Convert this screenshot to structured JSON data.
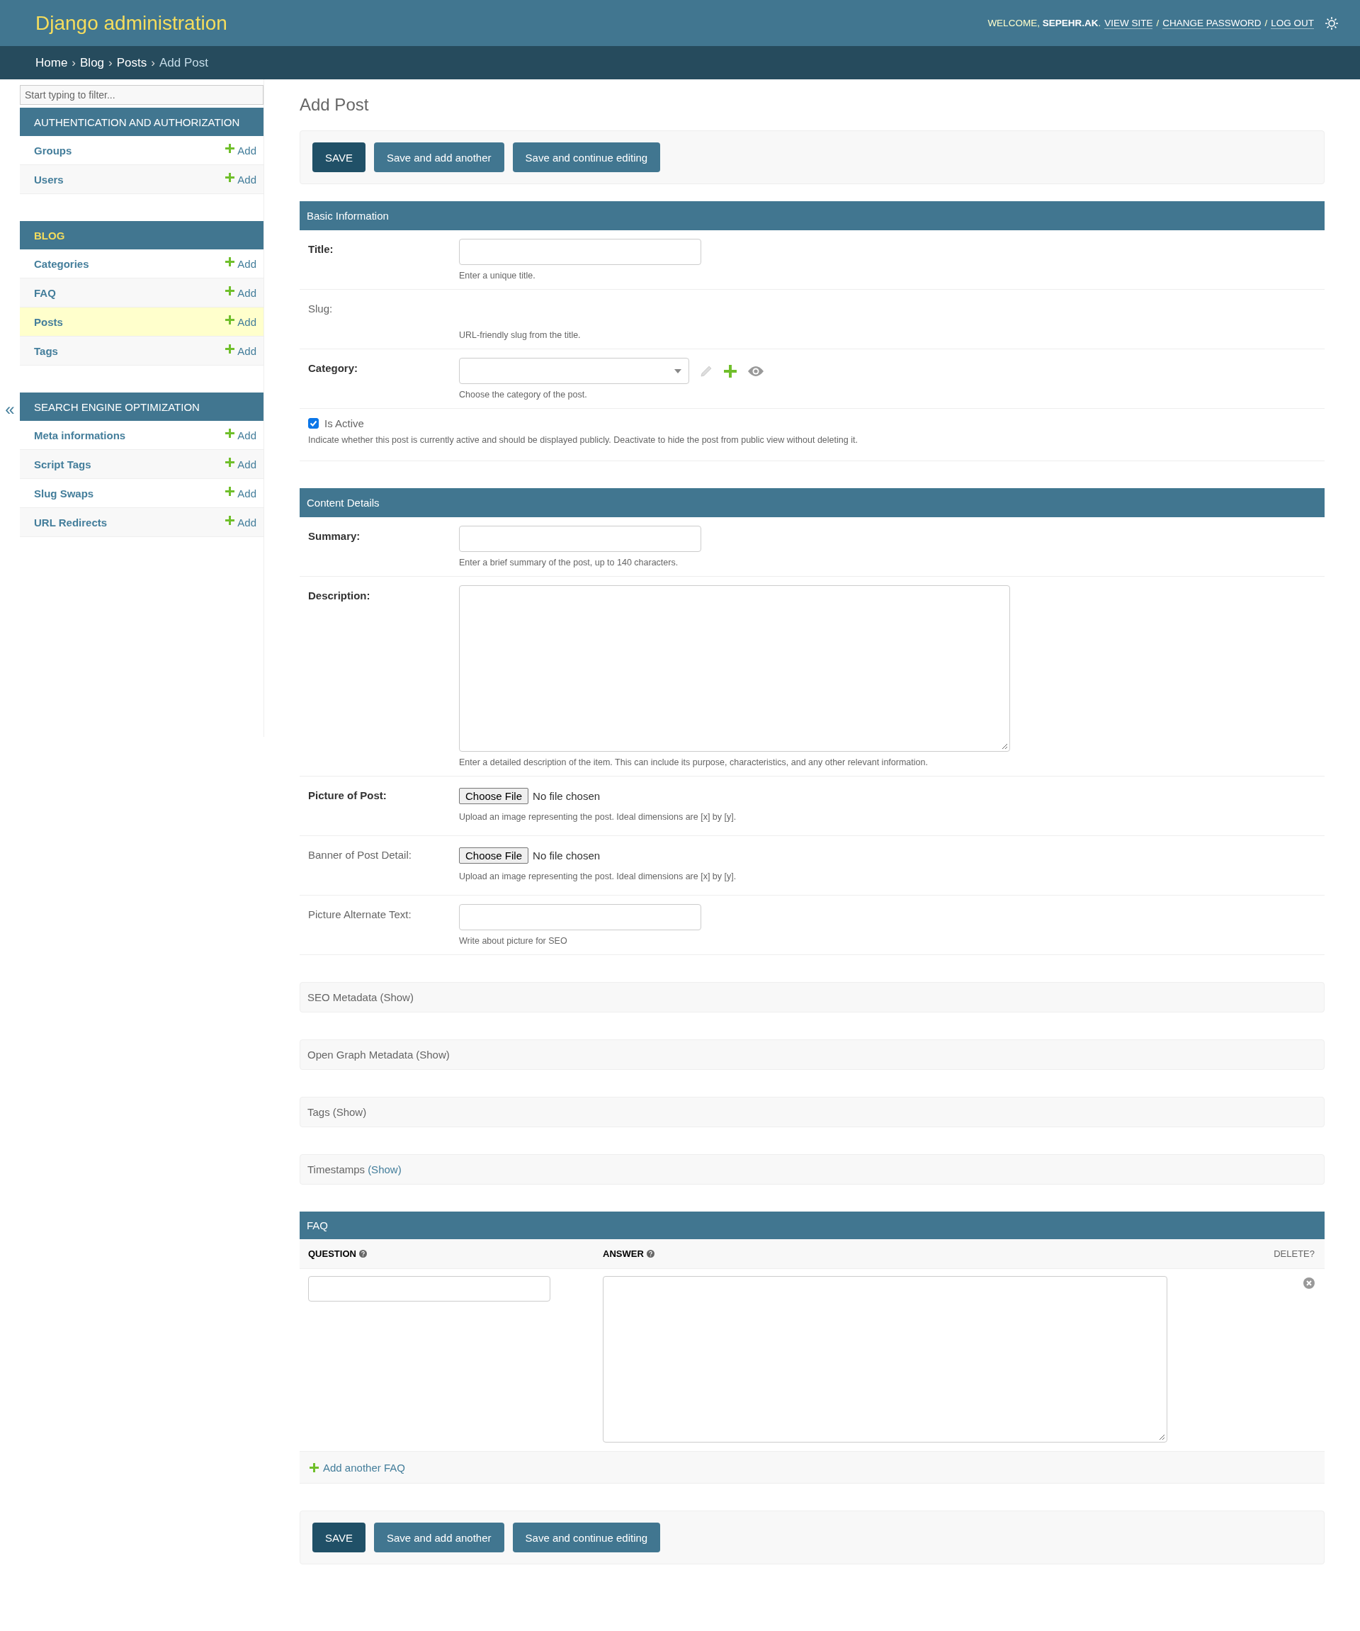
{
  "header": {
    "site_name": "Django administration",
    "welcome": "WELCOME, **SEPEHR.AK**.",
    "user_links": [
      {
        "kind": "link",
        "text": "VIEW SITE"
      },
      {
        "kind": "separator",
        "text": "/"
      },
      {
        "kind": "link",
        "text": "CHANGE PASSWORD"
      },
      {
        "kind": "separator",
        "text": "/"
      },
      {
        "kind": "link",
        "text": "LOG OUT"
      }
    ]
  },
  "breadcrumbs": [
    {
      "kind": "link",
      "text": "Home"
    },
    {
      "kind": "separator",
      "text": "›"
    },
    {
      "kind": "link",
      "text": "Blog"
    },
    {
      "kind": "separator",
      "text": "›"
    },
    {
      "kind": "link",
      "text": "Posts"
    },
    {
      "kind": "separator",
      "text": "›"
    },
    {
      "kind": "current",
      "text": "Add Post"
    }
  ],
  "sidebar": {
    "filter": {
      "placeholder": "Start typing to filter..."
    },
    "collapse_toggle": "«",
    "sections": [
      {
        "title": "AUTHENTICATION AND AUTHORIZATION",
        "selected": false,
        "items": [
          {
            "name": "Groups",
            "add": "Add",
            "selected": false
          },
          {
            "name": "Users",
            "add": "Add",
            "selected": false
          }
        ]
      },
      {
        "title": "BLOG",
        "selected": true,
        "items": [
          {
            "name": "Categories",
            "add": "Add",
            "selected": false
          },
          {
            "name": "FAQ",
            "add": "Add",
            "selected": false
          },
          {
            "name": "Posts",
            "add": "Add",
            "selected": true
          },
          {
            "name": "Tags",
            "add": "Add",
            "selected": false
          }
        ]
      },
      {
        "title": "SEARCH ENGINE OPTIMIZATION",
        "selected": false,
        "items": [
          {
            "name": "Meta informations",
            "add": "Add",
            "selected": false
          },
          {
            "name": "Script Tags",
            "add": "Add",
            "selected": false
          },
          {
            "name": "Slug Swaps",
            "add": "Add",
            "selected": false
          },
          {
            "name": "URL Redirects",
            "add": "Add",
            "selected": false
          }
        ]
      }
    ]
  },
  "page_title": "Add Post",
  "submit_row_top": {
    "buttons": [
      {
        "kind": "default",
        "label": "SAVE"
      },
      {
        "kind": "secondary",
        "label": "Save and add another"
      },
      {
        "kind": "secondary",
        "label": "Save and continue editing"
      }
    ]
  },
  "fieldsets": [
    {
      "title": "Basic Information",
      "fields": [
        {
          "kind": "text",
          "label": "Title:",
          "required": true,
          "help": "Enter a unique title."
        },
        {
          "kind": "empty",
          "label": "Slug:",
          "required": false,
          "help": "URL-friendly slug from the title."
        },
        {
          "kind": "select",
          "label": "Category:",
          "required": true,
          "help": "Choose the category of the post."
        },
        {
          "kind": "checkbox",
          "label": "Is Active",
          "checked": true,
          "help": "Indicate whether this post is currently active and should be displayed publicly. Deactivate to hide the post from public view without deleting it."
        }
      ]
    },
    {
      "title": "Content Details",
      "fields": [
        {
          "kind": "text",
          "label": "Summary:",
          "required": true,
          "help": "Enter a brief summary of the post, up to 140 characters."
        },
        {
          "kind": "textarea",
          "label": "Description:",
          "required": true,
          "help": "Enter a detailed description of the item. This can include its purpose, characteristics, and any other relevant information."
        },
        {
          "kind": "file",
          "label": "Picture of Post:",
          "required": true,
          "button": "Choose File",
          "status": "No file chosen",
          "help": "Upload an image representing the post. Ideal dimensions are [x] by [y]."
        },
        {
          "kind": "file",
          "label": "Banner of Post Detail:",
          "required": false,
          "button": "Choose File",
          "status": "No file chosen",
          "help": "Upload an image representing the post. Ideal dimensions are [x] by [y]."
        },
        {
          "kind": "text",
          "label": "Picture Alternate Text:",
          "required": false,
          "help": "Write about picture for SEO"
        }
      ]
    }
  ],
  "collapsed_fieldsets": [
    {
      "title": "SEO Metadata",
      "toggle": "(Show)",
      "selected": false
    },
    {
      "title": "Open Graph Metadata",
      "toggle": "(Show)",
      "selected": false
    },
    {
      "title": "Tags",
      "toggle": "(Show)",
      "selected": false
    },
    {
      "title": "Timestamps",
      "toggle": "(Show)",
      "selected": true
    }
  ],
  "faq_inline": {
    "title": "FAQ",
    "columns": [
      {
        "label": "QUESTION",
        "kind": "field"
      },
      {
        "label": "ANSWER",
        "kind": "field"
      },
      {
        "label": "DELETE?",
        "kind": "delete"
      }
    ],
    "rows": [
      {
        "kind": "empty_form"
      }
    ],
    "add_link": "Add another FAQ"
  },
  "submit_row_bottom": {
    "buttons": [
      {
        "kind": "default",
        "label": "SAVE"
      },
      {
        "kind": "secondary",
        "label": "Save and add another"
      },
      {
        "kind": "secondary",
        "label": "Save and continue editing"
      }
    ]
  }
}
